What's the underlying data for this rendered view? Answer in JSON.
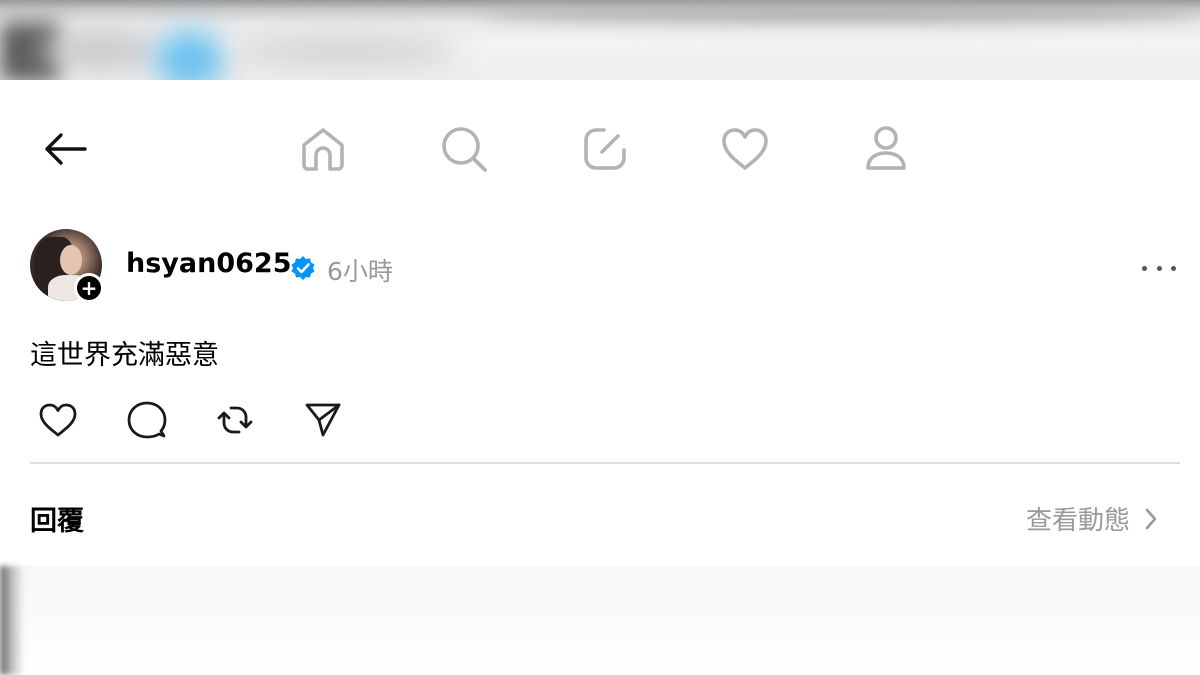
{
  "nav": {
    "back_icon": "arrow-left-icon",
    "icons": [
      "home-icon",
      "search-icon",
      "compose-icon",
      "heart-icon",
      "profile-icon"
    ]
  },
  "post": {
    "username": "hsyan0625",
    "verified_icon": "verified-badge-icon",
    "time": "6小時",
    "text": "這世界充滿惡意",
    "actions": [
      "like-icon",
      "comment-icon",
      "repost-icon",
      "share-icon"
    ]
  },
  "replies": {
    "label": "回覆",
    "view_activity": "查看動態"
  },
  "colors": {
    "verified_blue": "#0095f6",
    "secondary_text": "#999999",
    "icon_gray": "#b3b3b3",
    "icon_dark": "#000000"
  }
}
